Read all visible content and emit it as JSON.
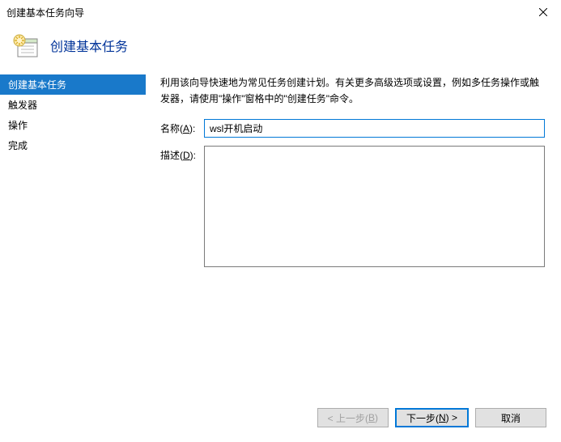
{
  "window": {
    "title": "创建基本任务向导"
  },
  "header": {
    "title": "创建基本任务"
  },
  "sidebar": {
    "items": [
      {
        "label": "创建基本任务"
      },
      {
        "label": "触发器"
      },
      {
        "label": "操作"
      },
      {
        "label": "完成"
      }
    ]
  },
  "main": {
    "intro": "利用该向导快速地为常见任务创建计划。有关更多高级选项或设置，例如多任务操作或触发器，请使用\"操作\"窗格中的\"创建任务\"命令。",
    "name_label_prefix": "名称(",
    "name_label_key": "A",
    "name_label_suffix": "):",
    "name_value": "wsl开机启动",
    "desc_label_prefix": "描述(",
    "desc_label_key": "D",
    "desc_label_suffix": "):",
    "desc_value": ""
  },
  "footer": {
    "back_prefix": "< 上一步(",
    "back_key": "B",
    "back_suffix": ")",
    "next_prefix": "下一步(",
    "next_key": "N",
    "next_suffix": ") >",
    "cancel": "取消"
  }
}
